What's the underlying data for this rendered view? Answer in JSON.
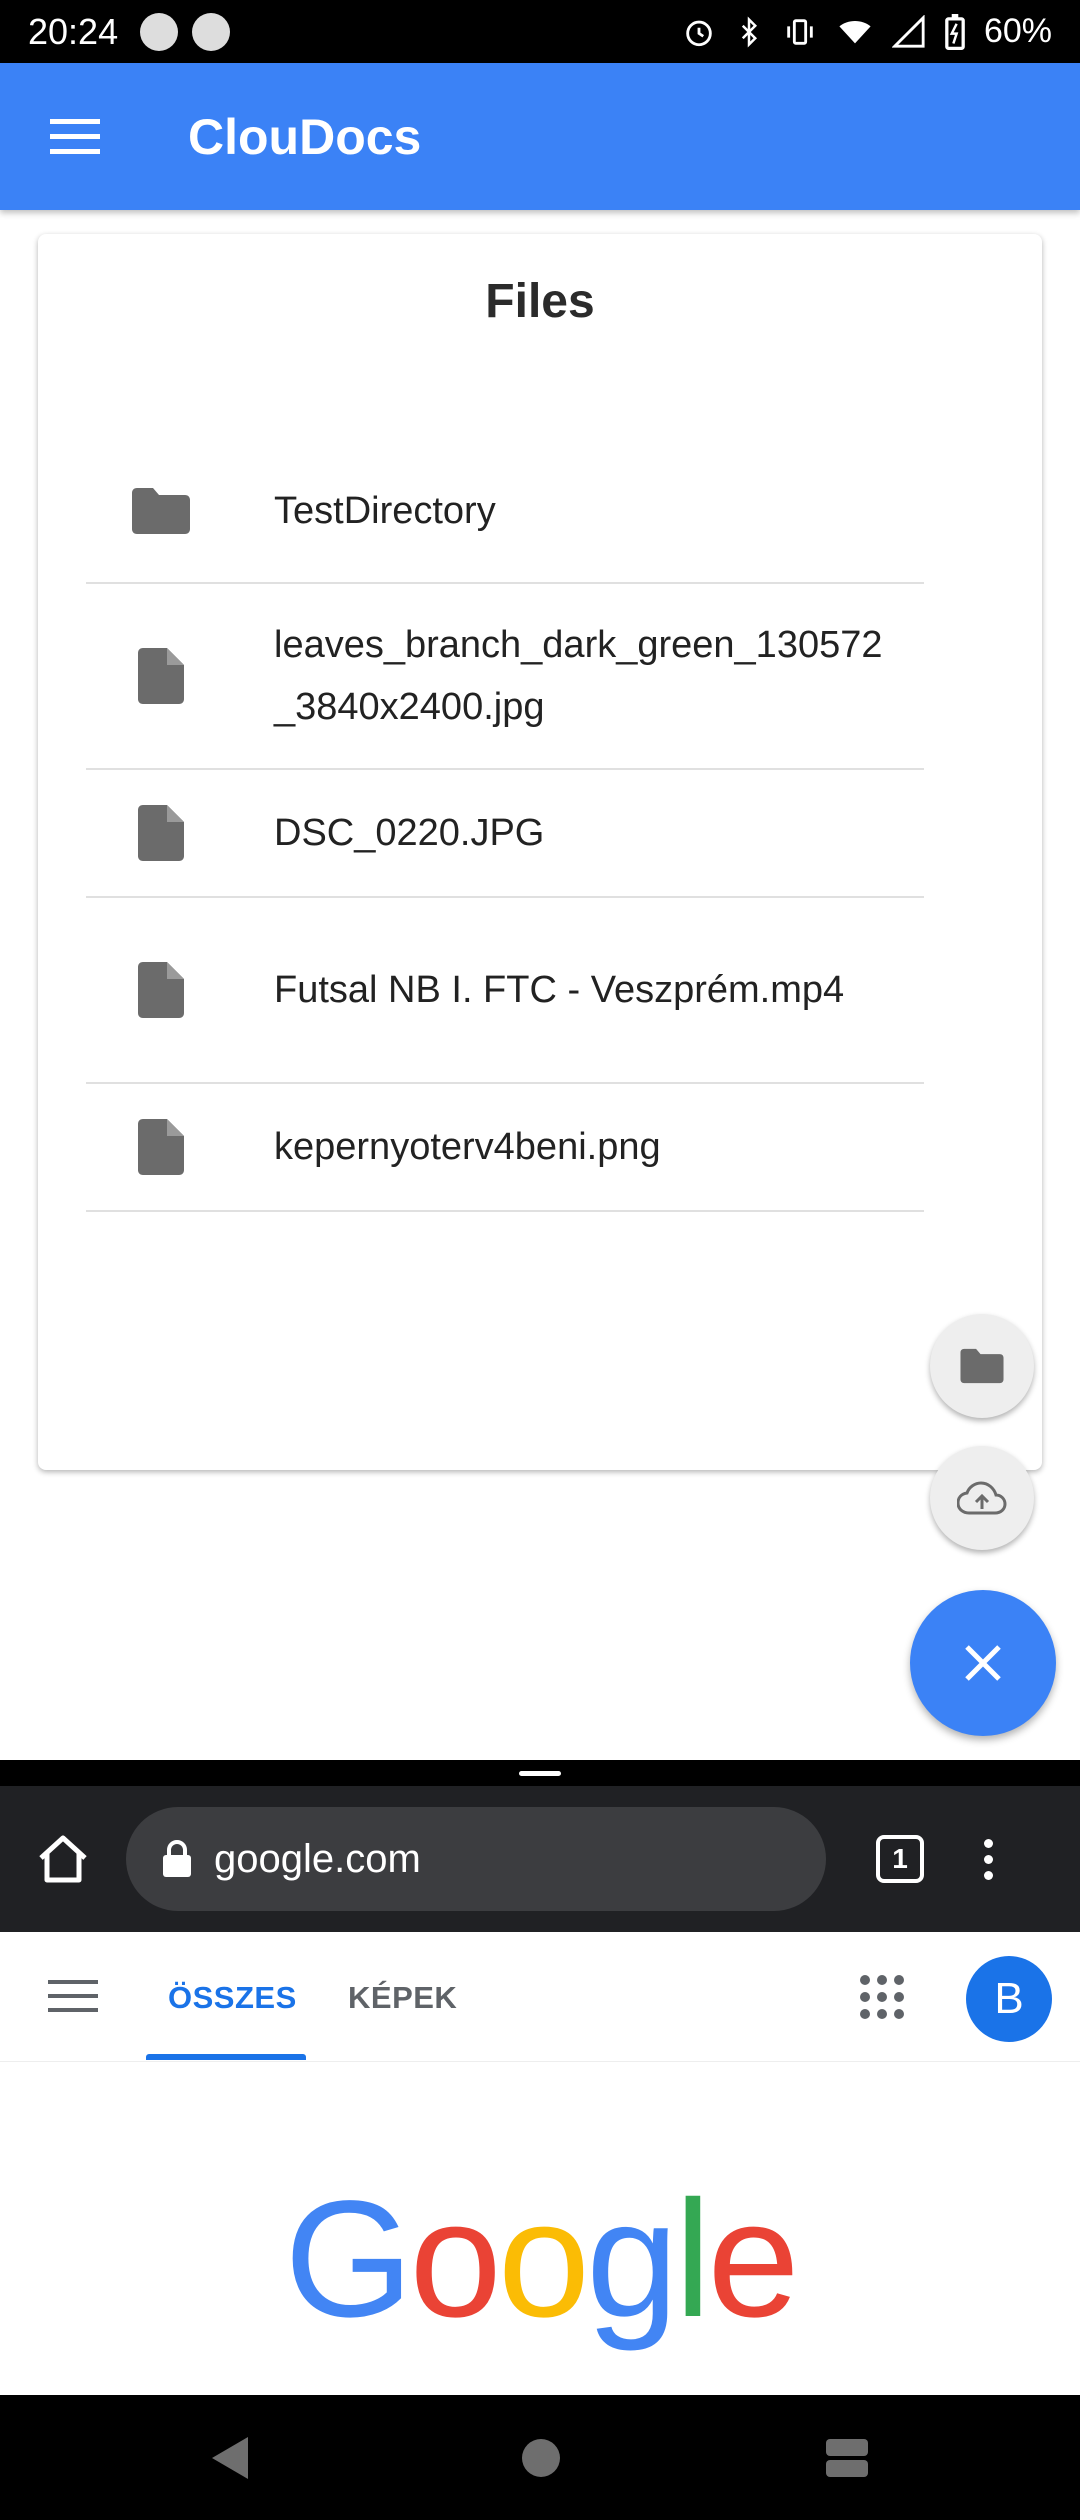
{
  "status_bar": {
    "time": "20:24",
    "battery": "60%"
  },
  "app_bar": {
    "title": "ClouDocs",
    "menu_icon": "menu-icon"
  },
  "files_card": {
    "heading": "Files",
    "items": [
      {
        "type": "folder",
        "name": "TestDirectory",
        "icon": "folder-icon"
      },
      {
        "type": "file",
        "name": "leaves_branch_dark_green_130572_3840x2400.jpg",
        "icon": "file-icon"
      },
      {
        "type": "file",
        "name": "DSC_0220.JPG",
        "icon": "file-icon"
      },
      {
        "type": "file",
        "name": "Futsal NB I. FTC - Veszprém.mp4",
        "icon": "file-icon"
      },
      {
        "type": "file",
        "name": "kepernyoterv4beni.png",
        "icon": "file-icon"
      }
    ]
  },
  "fab": {
    "new_folder_icon": "folder-icon",
    "upload_icon": "cloud-upload-icon",
    "close_icon": "close-icon"
  },
  "browser": {
    "url": "google.com",
    "tab_count": "1"
  },
  "google": {
    "tabs": [
      {
        "label": "ÖSSZES",
        "active": true
      },
      {
        "label": "KÉPEK",
        "active": false
      }
    ],
    "avatar_letter": "B",
    "logo": [
      "G",
      "o",
      "o",
      "g",
      "l",
      "e"
    ]
  },
  "colors": {
    "primary": "#3b82f6",
    "icon_grey": "#6b6b6b",
    "google_blue": "#1a73e8"
  }
}
